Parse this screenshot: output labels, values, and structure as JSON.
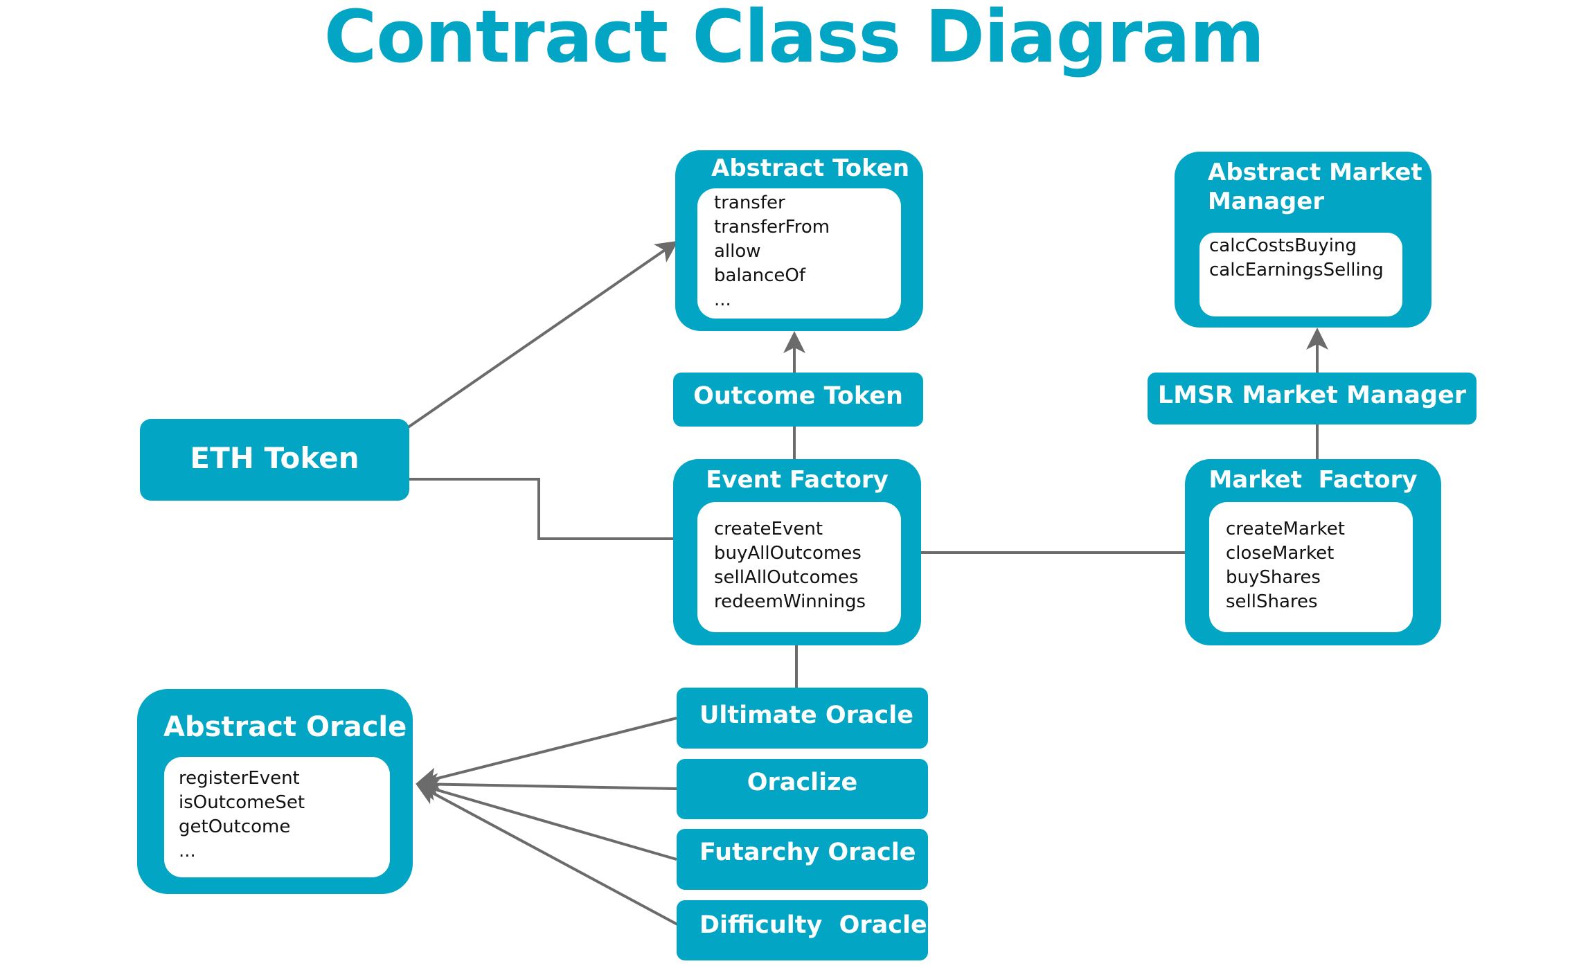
{
  "title": "Contract Class Diagram",
  "colors": {
    "box": "#02A6C4",
    "inner": "#ffffff",
    "connector": "#6b6b6b",
    "title": "#02A6C4",
    "method_text": "#111111",
    "box_text": "#ffffff"
  },
  "nodes": {
    "abstract_token": {
      "title": "Abstract Token",
      "methods": [
        "transfer",
        "transferFrom",
        "allow",
        "balanceOf",
        "..."
      ]
    },
    "abstract_market_manager": {
      "title_line1": "Abstract Market",
      "title_line2": "Manager",
      "methods": [
        "calcCostsBuying",
        "calcEarningsSelling"
      ]
    },
    "outcome_token": {
      "title": "Outcome Token"
    },
    "lmsr_market_manager": {
      "title": "LMSR Market Manager"
    },
    "eth_token": {
      "title": "ETH Token"
    },
    "event_factory": {
      "title": "Event Factory",
      "methods": [
        "createEvent",
        "buyAllOutcomes",
        "sellAllOutcomes",
        "redeemWinnings"
      ]
    },
    "market_factory": {
      "title": "Market  Factory",
      "methods": [
        "createMarket",
        "closeMarket",
        "buyShares",
        "sellShares"
      ]
    },
    "abstract_oracle": {
      "title": "Abstract Oracle",
      "methods": [
        "registerEvent",
        "isOutcomeSet",
        "getOutcome",
        "..."
      ]
    },
    "ultimate_oracle": {
      "title": "Ultimate Oracle"
    },
    "oraclize": {
      "title": "Oraclize"
    },
    "futarchy_oracle": {
      "title": "Futarchy Oracle"
    },
    "difficulty_oracle": {
      "title": "Difficulty  Oracle"
    }
  },
  "edges": [
    {
      "from": "ETH Token",
      "to": "Abstract Token",
      "type": "inheritance-arrow"
    },
    {
      "from": "ETH Token",
      "to": "Event Factory",
      "type": "association"
    },
    {
      "from": "Outcome Token",
      "to": "Abstract Token",
      "type": "inheritance-arrow"
    },
    {
      "from": "Event Factory",
      "to": "Outcome Token",
      "type": "association"
    },
    {
      "from": "Event Factory",
      "to": "Market  Factory",
      "type": "association"
    },
    {
      "from": "LMSR Market Manager",
      "to": "Abstract Market Manager",
      "type": "inheritance-arrow"
    },
    {
      "from": "Market  Factory",
      "to": "LMSR Market Manager",
      "type": "association"
    },
    {
      "from": "Event Factory",
      "to": "Ultimate Oracle",
      "type": "association"
    },
    {
      "from": "Ultimate Oracle",
      "to": "Abstract Oracle",
      "type": "inheritance-arrow"
    },
    {
      "from": "Oraclize",
      "to": "Abstract Oracle",
      "type": "inheritance-arrow"
    },
    {
      "from": "Futarchy Oracle",
      "to": "Abstract Oracle",
      "type": "inheritance-arrow"
    },
    {
      "from": "Difficulty  Oracle",
      "to": "Abstract Oracle",
      "type": "inheritance-arrow"
    }
  ]
}
